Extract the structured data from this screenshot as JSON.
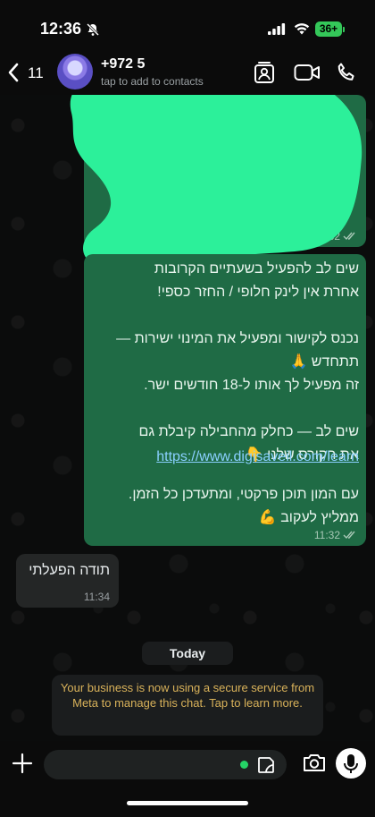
{
  "status": {
    "time": "12:36",
    "battery": "36+"
  },
  "header": {
    "back_count": "11",
    "contact_name": "+972 5",
    "contact_sub": "tap to add to contacts"
  },
  "chat": {
    "messages": [
      {
        "time": "11:32",
        "text": "שים לב להפעיל בשעתיים הקרובות\nאחרת אין לינק חלופי / החזר כספי!\n\nנכנס לקישור ומפעיל את המינוי ישירות —\nתתחדש 🙏\nזה מפעיל לך אותו ל-18 חודשים ישר.\n\nשים לב — כחלק מהחבילה קיבלת גם\nאת הקורס שלנו 👇",
        "link": "https://www.digisaveil.com/learn",
        "text2": "עם המון תוכן פרקטי, ומתעדכן כל הזמן.\nממליץ לעקוב 💪",
        "time2": "11:32"
      },
      {
        "text": "תודה הפעלתי",
        "time": "11:34"
      }
    ],
    "date_label": "Today",
    "system_note": "Your business is now using a secure service from Meta to manage this chat. Tap to learn more."
  },
  "colors": {
    "outgoing_bubble": "#1f6b45",
    "incoming_bubble": "#242626",
    "link": "#8ad0ff",
    "system_text": "#d9b25a",
    "redaction": "#2cf09a"
  },
  "icons": [
    "back-chevron-icon",
    "bell-slash-icon",
    "signal-icon",
    "wifi-icon",
    "contact-card-icon",
    "video-call-icon",
    "phone-icon",
    "read-receipt-icon",
    "plus-icon",
    "sticker-icon",
    "camera-icon",
    "microphone-icon"
  ]
}
